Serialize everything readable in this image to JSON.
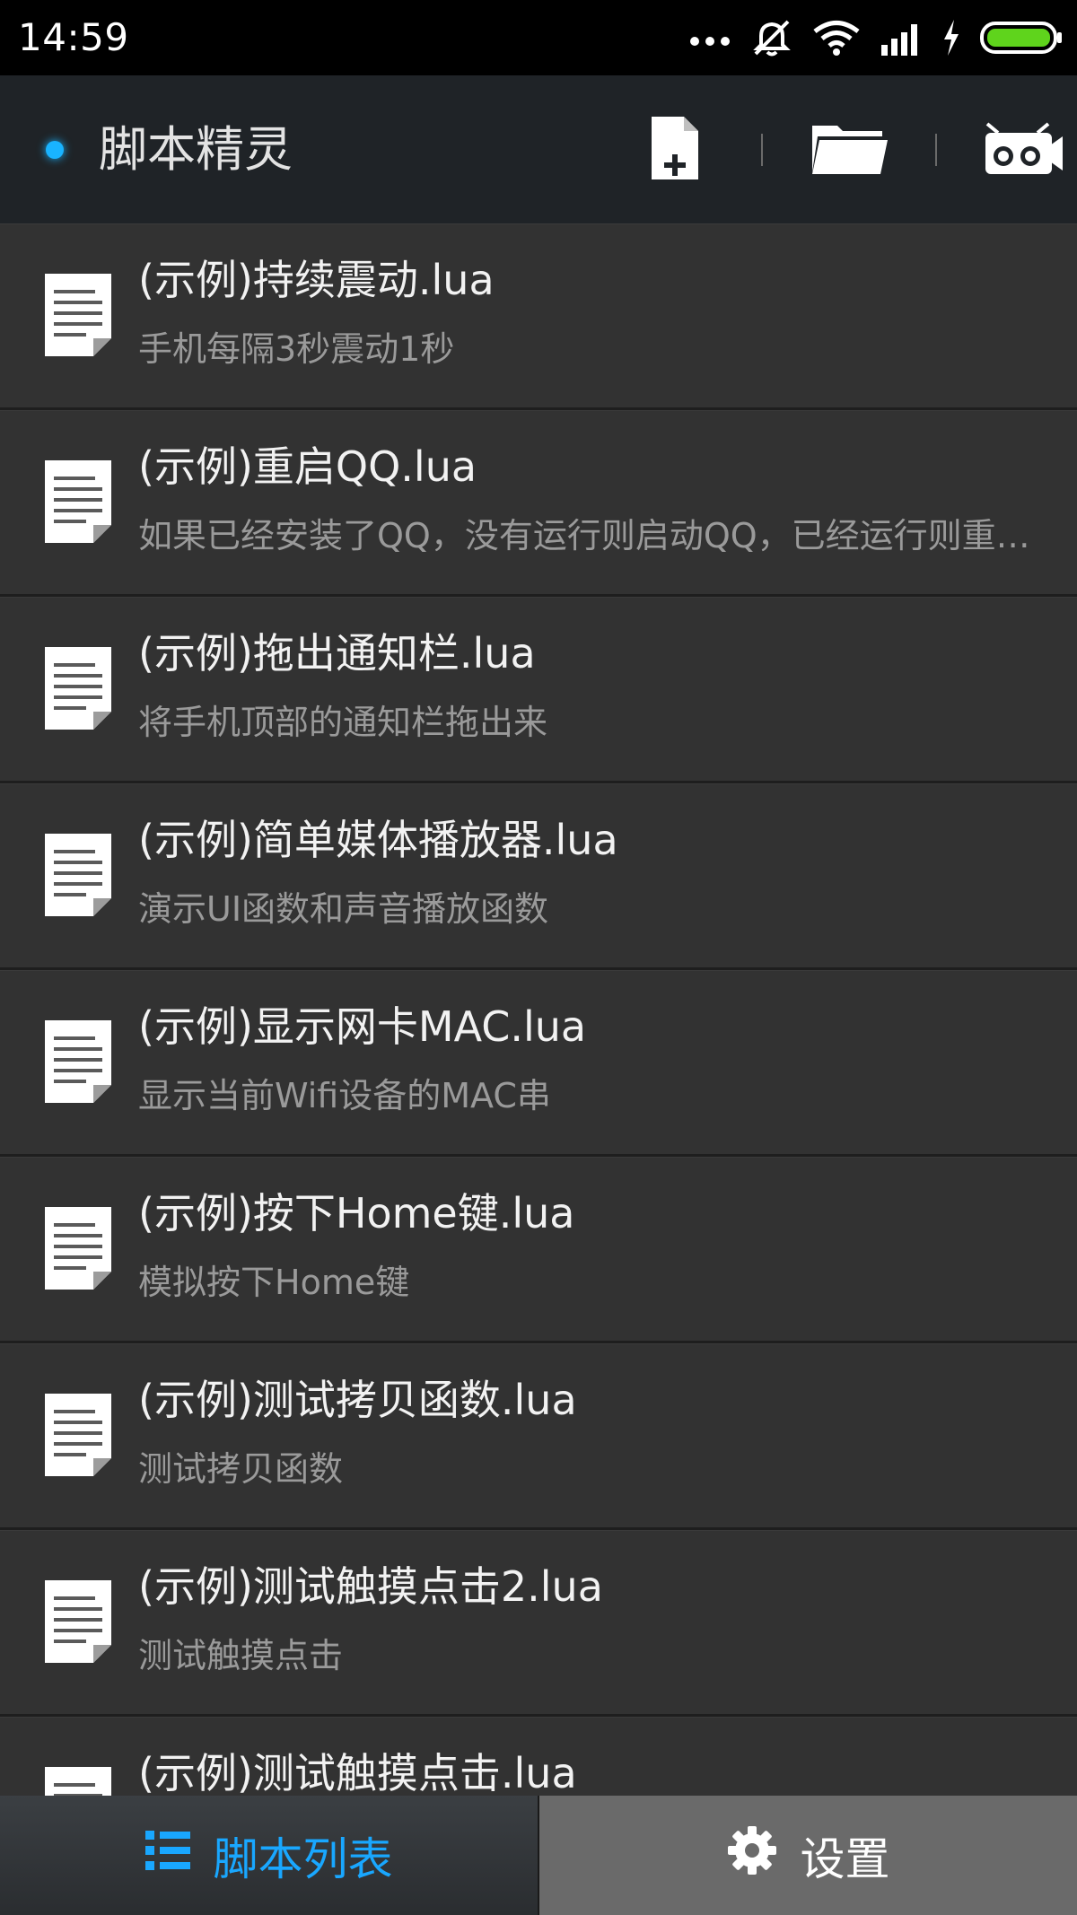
{
  "status_bar": {
    "time": "14:59",
    "icons": [
      "more-icon",
      "mute-icon",
      "wifi-icon",
      "signal-icon",
      "charging-icon",
      "battery-icon"
    ],
    "battery_color": "#5fd41c"
  },
  "app_bar": {
    "title": "脚本精灵",
    "accent_color": "#19b3ff",
    "actions": [
      "new-file-icon",
      "folder-icon",
      "record-icon"
    ]
  },
  "scripts": [
    {
      "name": "(示例)持续震动.lua",
      "desc": "手机每隔3秒震动1秒"
    },
    {
      "name": "(示例)重启QQ.lua",
      "desc": "如果已经安装了QQ，没有运行则启动QQ，已经运行则重启QQ"
    },
    {
      "name": "(示例)拖出通知栏.lua",
      "desc": "将手机顶部的通知栏拖出来"
    },
    {
      "name": "(示例)简单媒体播放器.lua",
      "desc": "演示UI函数和声音播放函数"
    },
    {
      "name": "(示例)显示网卡MAC.lua",
      "desc": "显示当前Wifi设备的MAC串"
    },
    {
      "name": "(示例)按下Home键.lua",
      "desc": "模拟按下Home键"
    },
    {
      "name": "(示例)测试拷贝函数.lua",
      "desc": "测试拷贝函数"
    },
    {
      "name": "(示例)测试触摸点击2.lua",
      "desc": "测试触摸点击"
    },
    {
      "name": "(示例)测试触摸点击.lua",
      "desc": ""
    }
  ],
  "bottom_tabs": {
    "list_label": "脚本列表",
    "settings_label": "设置"
  }
}
